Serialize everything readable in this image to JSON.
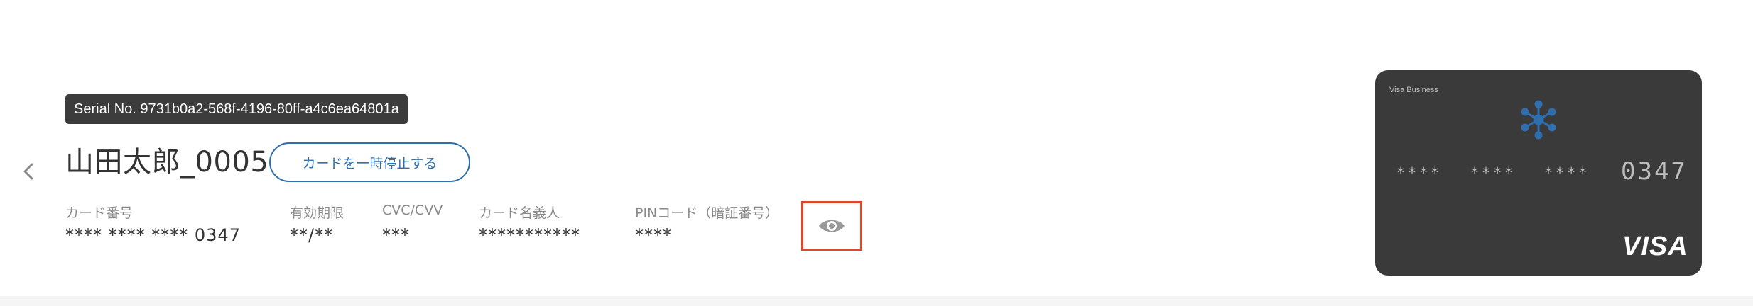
{
  "header": {
    "serial_label": "Serial No. 9731b0a2-568f-4196-80ff-a4c6ea64801a",
    "card_name": "山田太郎_0005",
    "pause_button_label": "カードを一時停止する"
  },
  "navigation": {
    "back_icon": "chevron-left-icon"
  },
  "fields": [
    {
      "label": "カード番号",
      "value": "**** **** **** 0347"
    },
    {
      "label": "有効期限",
      "value": "**/**"
    },
    {
      "label": "CVC/CVV",
      "value": "***"
    },
    {
      "label": "カード名義人",
      "value": "***********"
    },
    {
      "label": "PINコード（暗証番号）",
      "value": "****"
    }
  ],
  "reveal": {
    "icon": "eye-icon",
    "highlight_color": "#e2462a"
  },
  "card_preview": {
    "brand_text": "Visa Business",
    "masked_groups": [
      "****",
      "****",
      "****"
    ],
    "last4": "0347",
    "network": "VISA",
    "logo_icon": "network-node-icon",
    "card_color": "#3a3a3a",
    "logo_color": "#2f6fb0"
  },
  "colors": {
    "accent": "#2f6fb0",
    "serial_bg": "#3c3c3c"
  }
}
